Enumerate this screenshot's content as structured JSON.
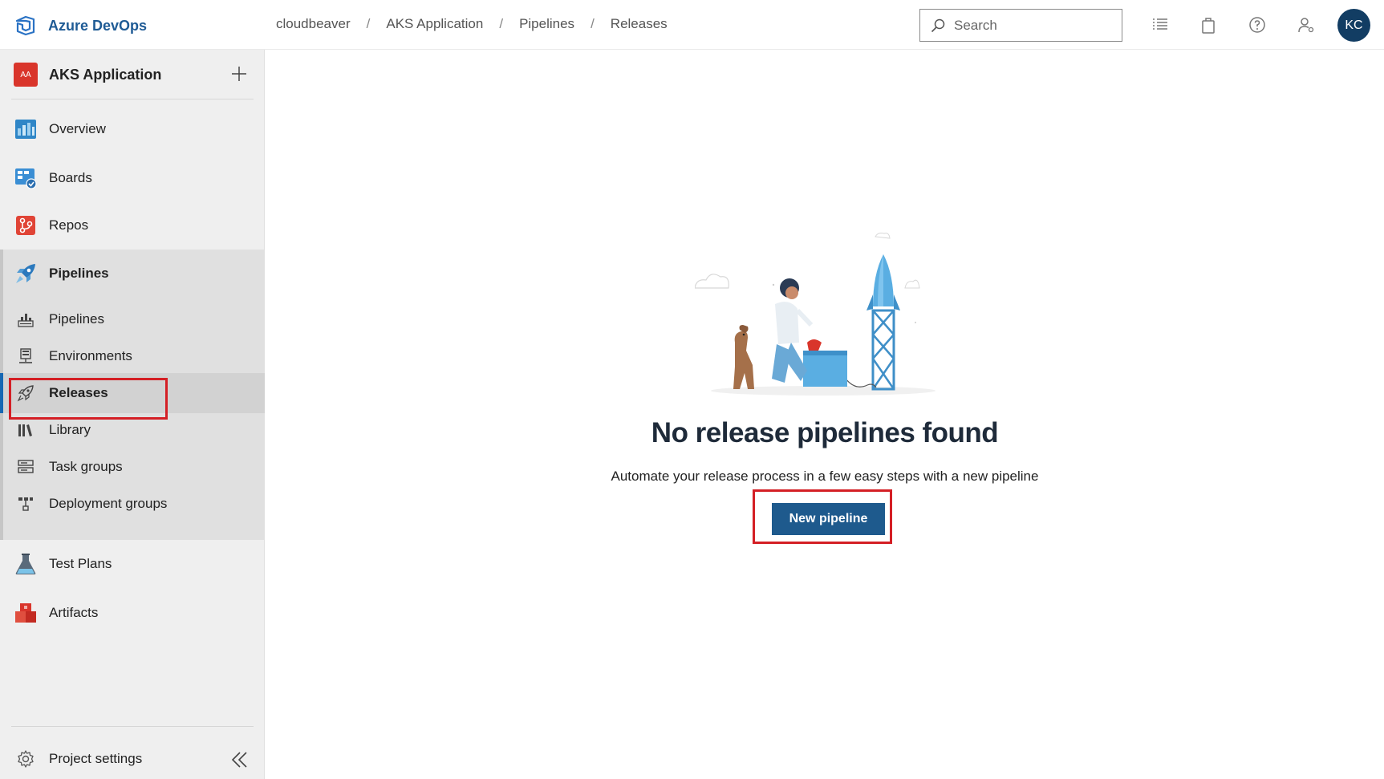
{
  "brand": {
    "name": "Azure DevOps",
    "icon": "azure-devops-logo"
  },
  "breadcrumb": [
    "cloudbeaver",
    "AKS Application",
    "Pipelines",
    "Releases"
  ],
  "breadcrumb_separator": "/",
  "search": {
    "placeholder": "Search"
  },
  "topbar_icons": [
    "work-items-list-icon",
    "marketplace-bag-icon",
    "help-icon",
    "user-settings-icon"
  ],
  "user": {
    "initials": "KC"
  },
  "project": {
    "badge": "AA",
    "name": "AKS Application",
    "badge_color": "#d9352b"
  },
  "nav": {
    "overview": "Overview",
    "boards": "Boards",
    "repos": "Repos",
    "pipelines": "Pipelines",
    "sub": {
      "pipelines": "Pipelines",
      "environments": "Environments",
      "releases": "Releases",
      "library": "Library",
      "task_groups": "Task groups",
      "deployment_groups": "Deployment groups"
    },
    "test_plans": "Test Plans",
    "artifacts": "Artifacts"
  },
  "settings": {
    "label": "Project settings"
  },
  "empty_state": {
    "title": "No release pipelines found",
    "description": "Automate your release process in a few easy steps with a new pipeline",
    "button": "New pipeline"
  },
  "colors": {
    "accent": "#1e5a8d",
    "highlight": "#d41f25",
    "avatar_bg": "#123d63"
  }
}
